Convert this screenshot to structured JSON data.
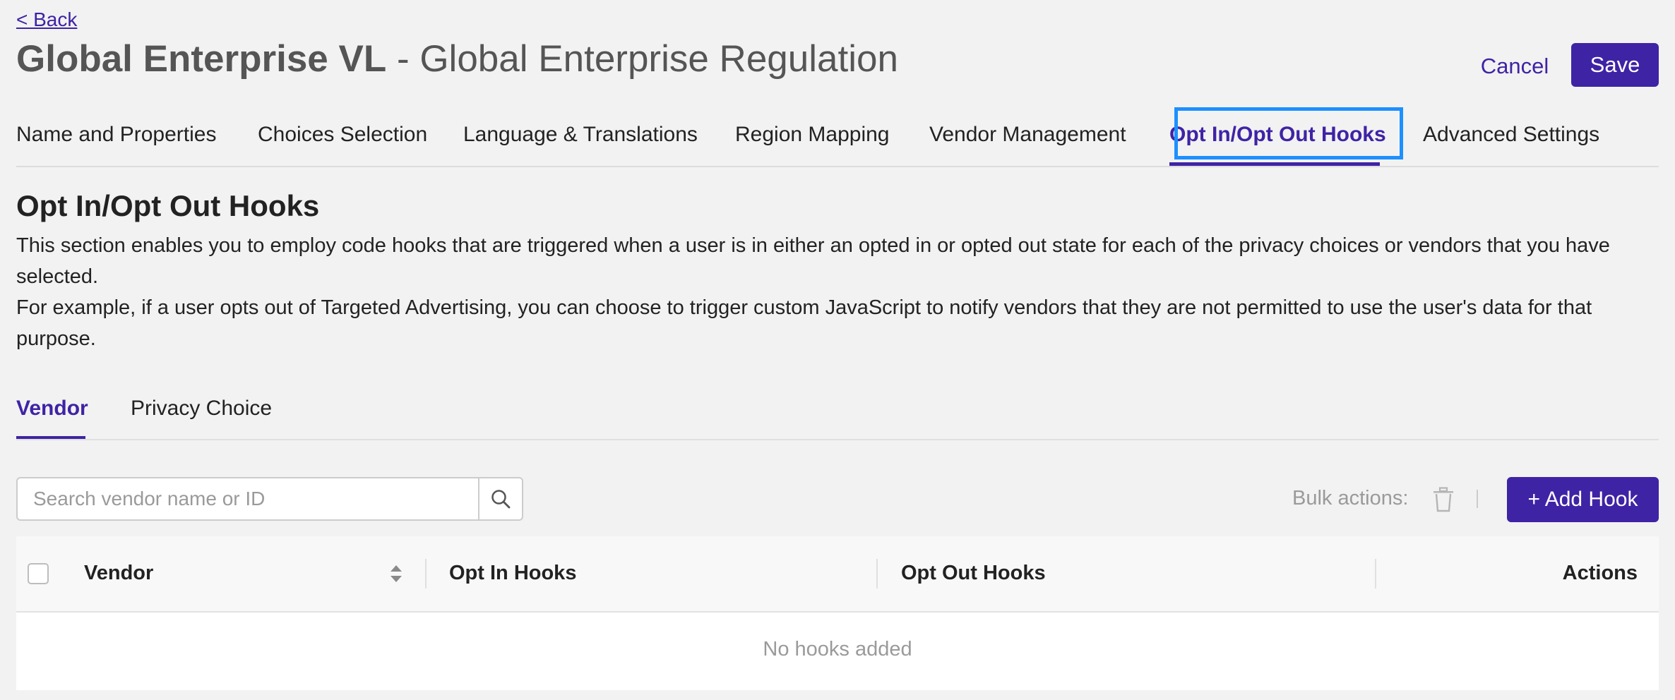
{
  "nav": {
    "back_label": "< Back"
  },
  "header": {
    "title_bold": "Global Enterprise VL",
    "title_rest": " - Global Enterprise Regulation",
    "cancel_label": "Cancel",
    "save_label": "Save"
  },
  "main_tabs": [
    {
      "label": "Name and Properties"
    },
    {
      "label": "Choices Selection"
    },
    {
      "label": "Language & Translations"
    },
    {
      "label": "Region Mapping"
    },
    {
      "label": "Vendor Management"
    },
    {
      "label": "Opt In/Opt Out Hooks",
      "active": true
    },
    {
      "label": "Advanced Settings"
    }
  ],
  "section": {
    "title": "Opt In/Opt Out Hooks",
    "description_1": "This section enables you to employ code hooks that are triggered when a user is in either an opted in or opted out state for each of the privacy choices or vendors that you have selected.",
    "description_2": "For example, if a user opts out of Targeted Advertising, you can choose to trigger custom JavaScript to notify vendors that they are not permitted to use the user's data for that purpose."
  },
  "sub_tabs": [
    {
      "label": "Vendor",
      "active": true
    },
    {
      "label": "Privacy Choice"
    }
  ],
  "toolbar": {
    "search_placeholder": "Search vendor name or ID",
    "bulk_actions_label": "Bulk actions:",
    "add_hook_label": "+ Add Hook"
  },
  "table": {
    "columns": [
      "Vendor",
      "Opt In Hooks",
      "Opt Out Hooks",
      "Actions"
    ],
    "empty_text": "No hooks added"
  },
  "icons": {
    "search": "search-icon",
    "trash": "trash-icon",
    "sort": "sort-icon"
  },
  "colors": {
    "accent": "#3f23a5",
    "focus_ring": "#1e8fff",
    "background": "#f2f2f2",
    "muted_text": "#9a9a9a"
  }
}
